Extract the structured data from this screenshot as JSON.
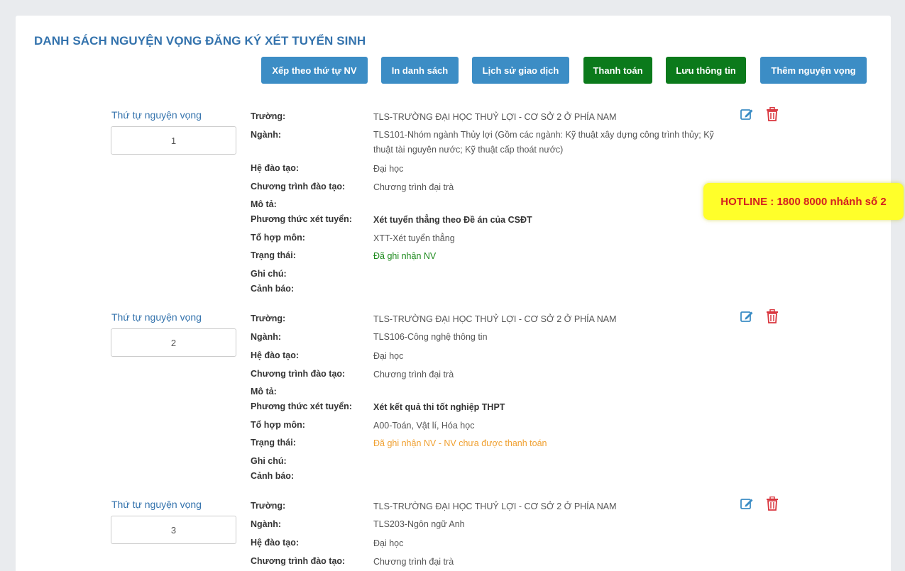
{
  "page_title": "DANH SÁCH NGUYỆN VỌNG ĐĂNG KÝ XÉT TUYỂN SINH",
  "toolbar": {
    "sort_label": "Xếp theo thứ tự NV",
    "print_label": "In danh sách",
    "history_label": "Lịch sử giao dịch",
    "pay_label": "Thanh toán",
    "save_label": "Lưu thông tin",
    "add_label": "Thêm nguyện vọng"
  },
  "labels": {
    "order": "Thứ tự nguyện vọng",
    "school": "Trường:",
    "major": "Ngành:",
    "system": "Hệ đào tạo:",
    "program": "Chương trình đào tạo:",
    "description": "Mô tả:",
    "method": "Phương thức xét tuyển:",
    "combo": "Tổ hợp môn:",
    "status": "Trạng thái:",
    "note": "Ghi chú:",
    "warning": "Cảnh báo:"
  },
  "wishes": [
    {
      "order": "1",
      "school": "TLS-TRƯỜNG ĐẠI HỌC THUỶ LỢI - CƠ SỞ 2 Ở PHÍA NAM",
      "major": "TLS101-Nhóm ngành Thủy lợi (Gồm các ngành: Kỹ thuật xây dựng công trình thủy; Kỹ thuật tài nguyên nước; Kỹ thuật cấp thoát nước)",
      "system": "Đại học",
      "program": "Chương trình đại trà",
      "description": "",
      "method": "Xét tuyển thẳng theo Đề án của CSĐT",
      "combo": "XTT-Xét tuyển thẳng",
      "status": "Đã ghi nhận NV",
      "status_color": "#1c8a1c",
      "note": "",
      "warning": ""
    },
    {
      "order": "2",
      "school": "TLS-TRƯỜNG ĐẠI HỌC THUỶ LỢI - CƠ SỞ 2 Ở PHÍA NAM",
      "major": "TLS106-Công nghệ thông tin",
      "system": "Đại học",
      "program": "Chương trình đại trà",
      "description": "",
      "method": "Xét kết quả thi tốt nghiệp THPT",
      "combo": "A00-Toán, Vật lí, Hóa học",
      "status": "Đã ghi nhận NV - NV chưa được thanh toán",
      "status_color": "#f0a030",
      "note": "",
      "warning": ""
    },
    {
      "order": "3",
      "school": "TLS-TRƯỜNG ĐẠI HỌC THUỶ LỢI - CƠ SỞ 2 Ở PHÍA NAM",
      "major": "TLS203-Ngôn ngữ Anh",
      "system": "Đại học",
      "program": "Chương trình đại trà"
    }
  ],
  "hotline": "HOTLINE : 1800 8000 nhánh số 2",
  "colors": {
    "title_blue": "#3473ad",
    "button_blue": "#3c8dc5",
    "button_green": "#0b7a1b",
    "delete_red": "#d9363e",
    "hotline_bg": "#ffff2a",
    "hotline_text": "#d42020"
  },
  "icons": {
    "edit": "edit-icon",
    "delete": "trash-icon"
  }
}
